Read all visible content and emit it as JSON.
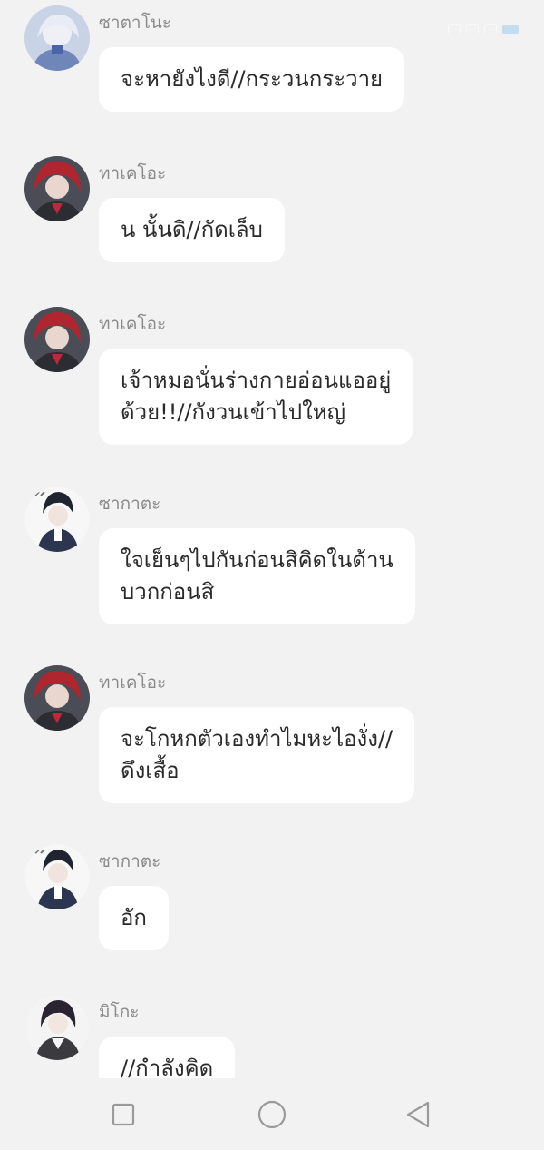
{
  "messages": [
    {
      "sender": "ซาตาโนะ",
      "text": "จะหายังไงดี//กระวนกระวาย",
      "avatar": "avatar-satano"
    },
    {
      "sender": "ทาเคโอะ",
      "text": "น นั้นดิ//กัดเล็บ",
      "avatar": "avatar-takeo"
    },
    {
      "sender": "ทาเคโอะ",
      "text": "เจ้าหมอนั่นร่างกายอ่อนแออยู่\nด้วย!!//กังวนเข้าไปใหญ่",
      "avatar": "avatar-takeo"
    },
    {
      "sender": "ซากาตะ",
      "text": "ใจเย็นๆไปกันก่อนสิคิดในด้าน\nบวกก่อนสิ",
      "avatar": "avatar-sakata"
    },
    {
      "sender": "ทาเคโอะ",
      "text": "จะโกหกตัวเองทำไมหะไองั่ง//\nดึงเสื้อ",
      "avatar": "avatar-takeo"
    },
    {
      "sender": "ซากาตะ",
      "text": "อัก",
      "avatar": "avatar-sakata"
    },
    {
      "sender": "มิโกะ",
      "text": "//กำลังคิด",
      "avatar": "avatar-miko"
    }
  ],
  "colors": {
    "background": "#f2f2f2",
    "bubble": "#ffffff",
    "sender_text": "#8a8a8a",
    "message_text": "#2a2a2a",
    "nav_icon": "#9a9a9a"
  },
  "navbar": {
    "icons": [
      "recent-apps-square-icon",
      "home-circle-icon",
      "back-triangle-icon"
    ]
  }
}
